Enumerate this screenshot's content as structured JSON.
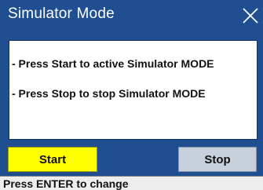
{
  "window": {
    "title": "Simulator Mode",
    "close_icon": "close-x-icon",
    "background_color": "#1f4f90"
  },
  "message": {
    "lines": [
      "- Press Start to active Simulator MODE",
      "- Press Stop to stop Simulator MODE"
    ]
  },
  "buttons": {
    "start_label": "Start",
    "stop_label": "Stop",
    "start_color": "#ffff00",
    "stop_color": "#c9d0dd"
  },
  "status": {
    "text": "Press ENTER to change"
  }
}
